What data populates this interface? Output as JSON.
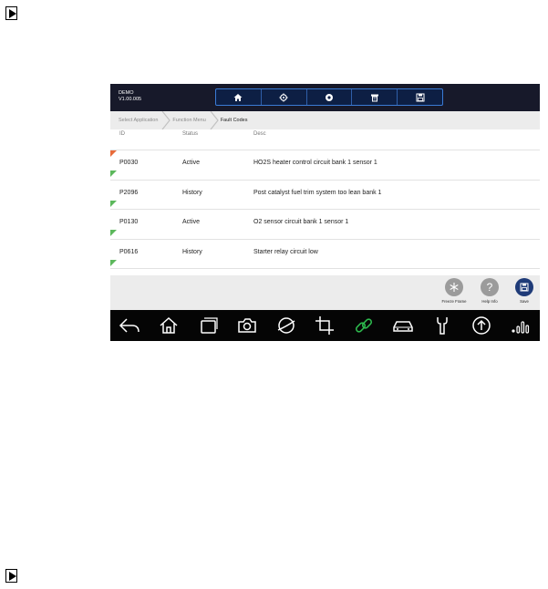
{
  "header": {
    "mode": "DEMO",
    "version": "V1.00.005"
  },
  "toolbar": {
    "icons": [
      "home-icon",
      "settings-icon",
      "record-icon",
      "print-icon",
      "save-icon"
    ]
  },
  "breadcrumb": [
    "Select Application",
    "Function Menu",
    "Fault Codes"
  ],
  "table": {
    "columns": [
      "ID",
      "Status",
      "Desc"
    ],
    "rows": [
      {
        "id": "P0030",
        "status": "Active",
        "desc": "HO2S heater control circuit bank 1  sensor 1"
      },
      {
        "id": "P2096",
        "status": "History",
        "desc": "Post catalyst fuel trim system too lean bank 1"
      },
      {
        "id": "P0130",
        "status": "Active",
        "desc": "O2 sensor circuit bank 1 sensor 1"
      },
      {
        "id": "P0616",
        "status": "History",
        "desc": "Starter relay circuit low"
      }
    ]
  },
  "actions": {
    "freeze_frame": "Freeze Frame",
    "help_info": "Help Info",
    "save": "Save"
  },
  "colors": {
    "topbar": "#17192a",
    "accent_blue": "#3a7bd5",
    "save_button": "#1f3b78",
    "gray_button": "#9b9b9b",
    "active_link": "#2db84d"
  },
  "navbar": {
    "icons": [
      "back-icon",
      "home-icon",
      "recent-apps-icon",
      "camera-icon",
      "browser-icon",
      "crop-icon",
      "link-icon",
      "car-icon",
      "wrench-icon",
      "upload-icon",
      "signal-icon"
    ]
  }
}
